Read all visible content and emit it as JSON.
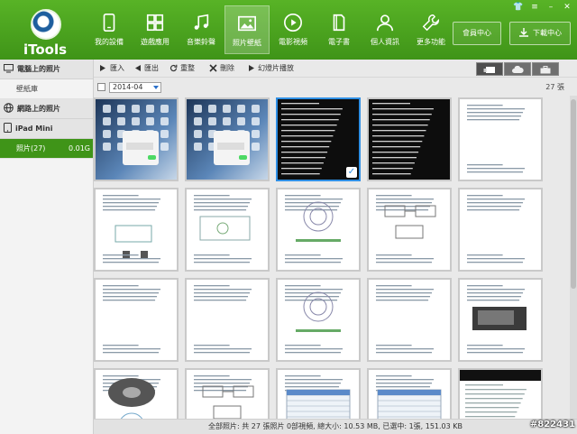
{
  "app": {
    "name": "iTools"
  },
  "nav": [
    {
      "label": "我的設備",
      "icon": "phone-icon"
    },
    {
      "label": "遊戲應用",
      "icon": "apps-icon"
    },
    {
      "label": "音樂鈴聲",
      "icon": "music-icon"
    },
    {
      "label": "照片壁紙",
      "icon": "photo-icon",
      "active": true
    },
    {
      "label": "電影視頻",
      "icon": "video-icon"
    },
    {
      "label": "電子書",
      "icon": "book-icon"
    },
    {
      "label": "個人資訊",
      "icon": "person-icon"
    },
    {
      "label": "更多功能",
      "icon": "wrench-icon"
    }
  ],
  "header": {
    "member_label": "會員中心",
    "download_label": "下載中心"
  },
  "window_controls": {
    "skin": "👕",
    "menu": "≡",
    "minimize": "–",
    "close": "✕"
  },
  "sidebar": {
    "pc_section": "電腦上的照片",
    "pc_items": [
      {
        "label": "壁紙庫"
      }
    ],
    "web_section": "網路上的照片",
    "device_section": "iPad Mini",
    "device_items": [
      {
        "label": "照片(27)",
        "size": "0.01G",
        "active": true
      }
    ]
  },
  "toolbar": {
    "import": "匯入",
    "export": "匯出",
    "refresh": "重整",
    "delete": "刪除",
    "slideshow": "幻燈片播放"
  },
  "filter": {
    "date": "2014-04",
    "count": "27 張"
  },
  "status": "全部照片: 共 27 張照片 0部視頻, 總大小: 10.53 MB, 已選中: 1張, 151.03 KB",
  "watermark": "#822431",
  "thumbs": [
    {
      "kind": "ipad"
    },
    {
      "kind": "ipad"
    },
    {
      "kind": "darklist",
      "selected": true
    },
    {
      "kind": "darklist2"
    },
    {
      "kind": "doc"
    },
    {
      "kind": "doc-fig"
    },
    {
      "kind": "doc-fig2"
    },
    {
      "kind": "doc-circle"
    },
    {
      "kind": "doc-diagram"
    },
    {
      "kind": "doc"
    },
    {
      "kind": "doc"
    },
    {
      "kind": "doc"
    },
    {
      "kind": "doc-circle2"
    },
    {
      "kind": "doc"
    },
    {
      "kind": "doc-photo"
    },
    {
      "kind": "doc-disk"
    },
    {
      "kind": "doc-diagram"
    },
    {
      "kind": "doc-table"
    },
    {
      "kind": "doc-table"
    },
    {
      "kind": "doc-black"
    }
  ]
}
